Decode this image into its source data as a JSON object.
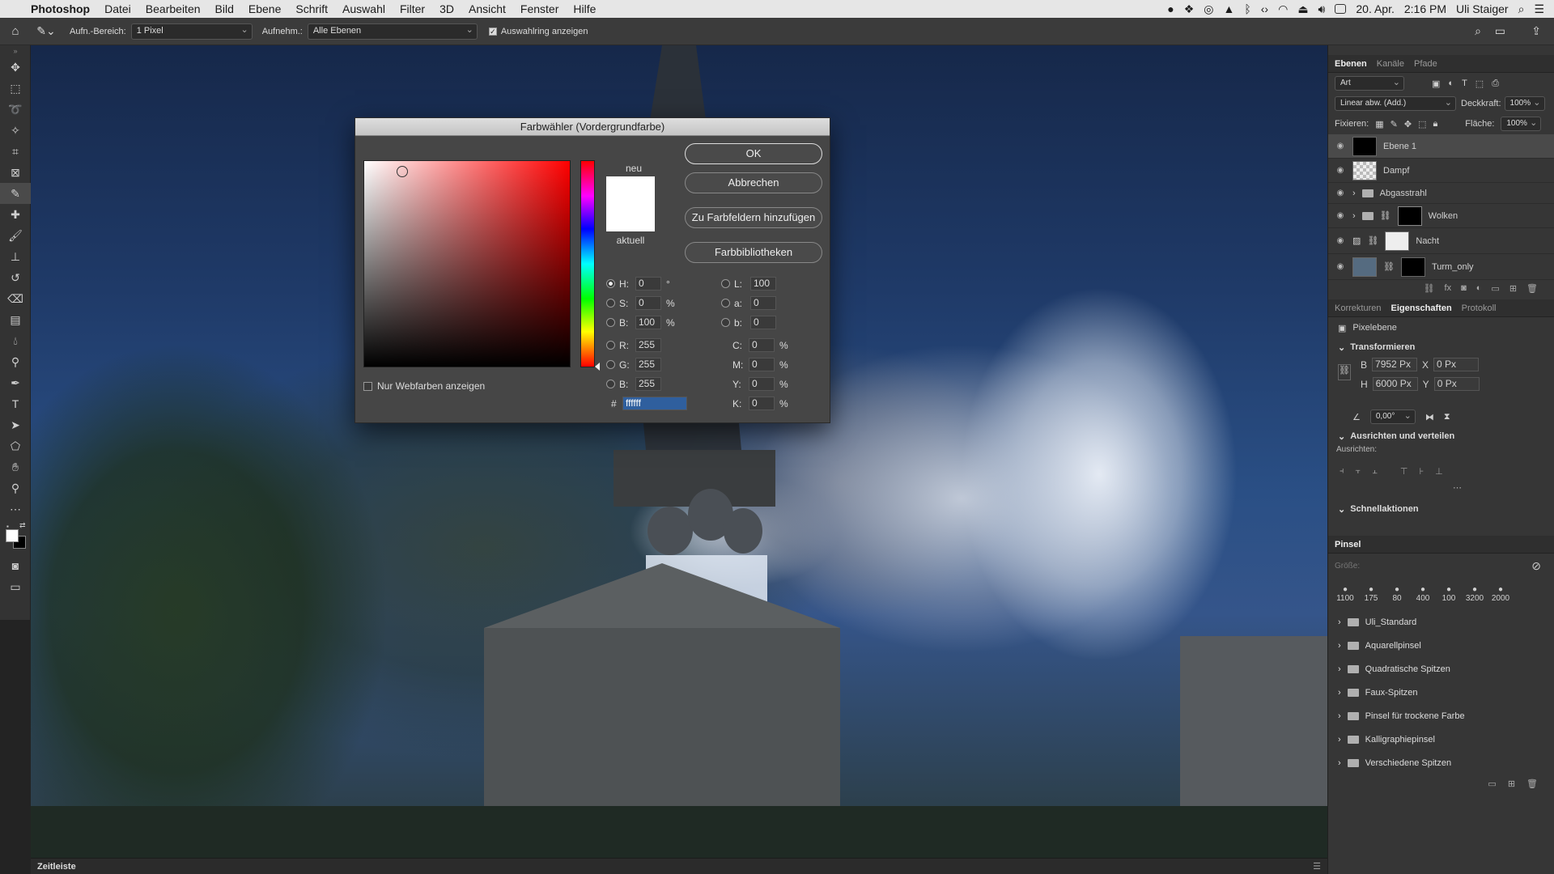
{
  "menubar": {
    "app": "Photoshop",
    "items": [
      "Datei",
      "Bearbeiten",
      "Bild",
      "Ebene",
      "Schrift",
      "Auswahl",
      "Filter",
      "3D",
      "Ansicht",
      "Fenster",
      "Hilfe"
    ],
    "date": "20. Apr.",
    "time": "2:16 PM",
    "user": "Uli Staiger"
  },
  "options": {
    "sample_size_label": "Aufn.-Bereich:",
    "sample_size": "1 Pixel",
    "sample_label": "Aufnehm.:",
    "sample": "Alle Ebenen",
    "show_ring": "Auswahlring anzeigen"
  },
  "dialog": {
    "title": "Farbwähler (Vordergrundfarbe)",
    "new_label": "neu",
    "current_label": "aktuell",
    "ok": "OK",
    "cancel": "Abbrechen",
    "add_swatch": "Zu Farbfeldern hinzufügen",
    "libraries": "Farbbibliotheken",
    "web_only": "Nur Webfarben anzeigen",
    "H": "0",
    "S": "0",
    "B": "100",
    "R": "255",
    "G": "255",
    "Bv": "255",
    "L": "100",
    "a": "0",
    "b": "0",
    "C": "0",
    "M": "0",
    "Y": "0",
    "K": "0",
    "hex": "ffffff",
    "unit_deg": "°",
    "unit_pct": "%",
    "new_color": "#ffffff",
    "current_color": "#ffffff"
  },
  "layers_panel": {
    "tabs": [
      "Ebenen",
      "Kanäle",
      "Pfade"
    ],
    "filter": "Art",
    "blend_mode": "Linear abw. (Add.)",
    "opacity_label": "Deckkraft:",
    "opacity": "100%",
    "lock_label": "Fixieren:",
    "fill_label": "Fläche:",
    "fill": "100%",
    "layers": [
      {
        "name": "Ebene 1"
      },
      {
        "name": "Dampf"
      },
      {
        "name": "Abgasstrahl"
      },
      {
        "name": "Wolken"
      },
      {
        "name": "Nacht"
      },
      {
        "name": "Turm_only"
      }
    ]
  },
  "props_panel": {
    "tabs": [
      "Korrekturen",
      "Eigenschaften",
      "Protokoll"
    ],
    "kind": "Pixelebene",
    "transform": "Transformieren",
    "w_label": "B",
    "w": "7952 Px",
    "h_label": "H",
    "h": "6000 Px",
    "x_label": "X",
    "x": "0 Px",
    "y_label": "Y",
    "y": "0 Px",
    "angle": "0,00°",
    "align": "Ausrichten und verteilen",
    "align_sub": "Ausrichten:",
    "quick": "Schnellaktionen"
  },
  "brushes_panel": {
    "title": "Pinsel",
    "size_label": "Größe:",
    "sizes": [
      "1100",
      "175",
      "80",
      "400",
      "100",
      "3200",
      "2000"
    ],
    "folders": [
      "Uli_Standard",
      "Aquarellpinsel",
      "Quadratische Spitzen",
      "Faux-Spitzen",
      "Pinsel für trockene Farbe",
      "Kalligraphiepinsel",
      "Verschiedene Spitzen"
    ]
  },
  "timeline": "Zeitleiste"
}
